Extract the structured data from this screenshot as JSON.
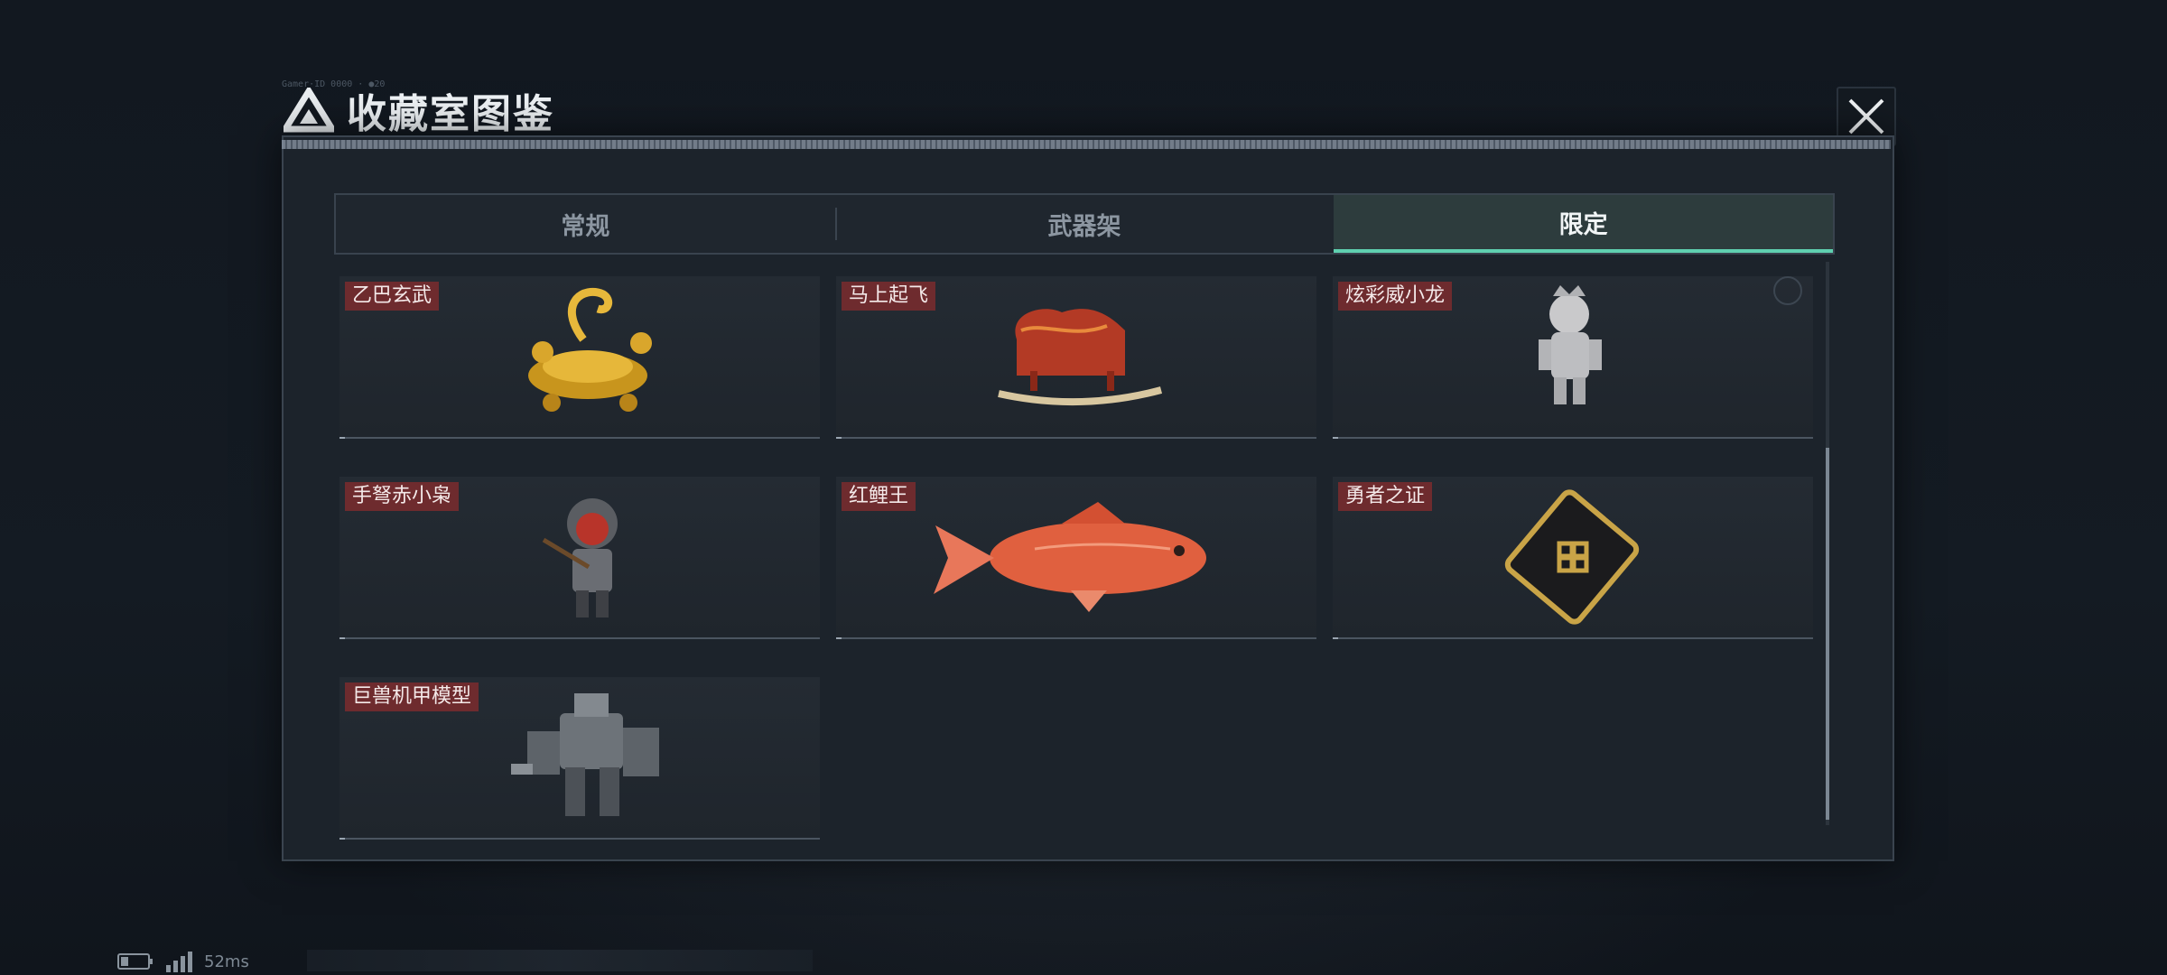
{
  "window": {
    "title": "收藏室图鉴",
    "header_noise": "Gamer·ID 0000 · ●20"
  },
  "icons": {
    "logo": "triangle-emblem-icon",
    "close": "close-icon",
    "battery": "battery-icon",
    "signal": "signal-icon"
  },
  "tabs": [
    {
      "label": "常规",
      "active": false
    },
    {
      "label": "武器架",
      "active": false
    },
    {
      "label": "限定",
      "active": true
    }
  ],
  "items": [
    {
      "name": "乙巴玄武",
      "art": "golden-turtle-snake"
    },
    {
      "name": "马上起飞",
      "art": "red-rocking-horse"
    },
    {
      "name": "炫彩威小龙",
      "art": "silver-dragon-doll"
    },
    {
      "name": "手弩赤小枭",
      "art": "hooded-crossbow-figure"
    },
    {
      "name": "红鲤王",
      "art": "red-carp"
    },
    {
      "name": "勇者之证",
      "art": "gold-emblem-card"
    },
    {
      "name": "巨兽机甲模型",
      "art": "mech-model"
    }
  ],
  "status": {
    "ping": "52ms"
  },
  "colors": {
    "accent": "#5fd0b0",
    "label_bg": "#6e2b2e",
    "panel_bg": "#1c232b"
  }
}
